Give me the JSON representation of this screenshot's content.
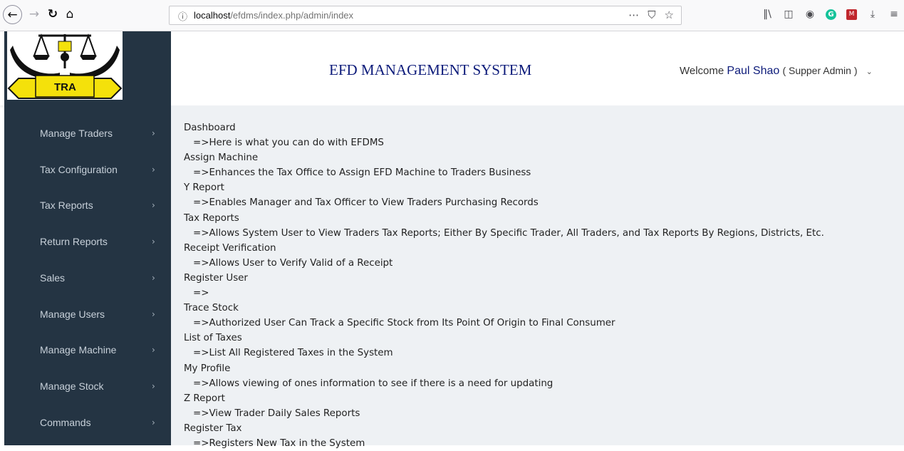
{
  "browser": {
    "url_prefix": "localhost",
    "url_rest": "/efdms/index.php/admin/index",
    "url_more": "⋯",
    "url_pocket": "⛉",
    "url_star": "☆"
  },
  "header": {
    "logo_text": "TRA",
    "title": "EFD MANAGEMENT SYSTEM",
    "welcome_prefix": "Welcome",
    "user_name": "Paul Shao",
    "user_role": "( Supper Admin )"
  },
  "sidebar": {
    "items": [
      {
        "label": "Manage Traders"
      },
      {
        "label": "Tax Configuration"
      },
      {
        "label": "Tax Reports"
      },
      {
        "label": "Return Reports"
      },
      {
        "label": "Sales"
      },
      {
        "label": "Manage Users"
      },
      {
        "label": "Manage Machine"
      },
      {
        "label": "Manage Stock"
      },
      {
        "label": "Commands"
      }
    ]
  },
  "main": {
    "entries": [
      {
        "title": "Dashboard",
        "desc": "=>Here is what you can do with EFDMS"
      },
      {
        "title": "Assign Machine",
        "desc": "=>Enhances the Tax Office to Assign EFD Machine to Traders Business"
      },
      {
        "title": "Y Report",
        "desc": "=>Enables Manager and Tax Officer to View Traders Purchasing Records"
      },
      {
        "title": "Tax Reports",
        "desc": "=>Allows System User to View Traders Tax Reports; Either By Specific Trader, All Traders, and Tax Reports By Regions, Districts, Etc."
      },
      {
        "title": "Receipt Verification",
        "desc": "=>Allows User to Verify Valid of a Receipt"
      },
      {
        "title": "Register User",
        "desc": "=>"
      },
      {
        "title": "Trace Stock",
        "desc": "=>Authorized User Can Track a Specific Stock from Its Point Of Origin to Final Consumer"
      },
      {
        "title": "List of Taxes",
        "desc": "=>List All Registered Taxes in the System"
      },
      {
        "title": "My Profile",
        "desc": "=>Allows viewing of ones information to see if there is a need for updating"
      },
      {
        "title": "Z Report",
        "desc": "=>View Trader Daily Sales Reports"
      },
      {
        "title": "Register Tax",
        "desc": "=>Registers New Tax in the System"
      }
    ]
  },
  "colors": {
    "sidebar_bg": "#243443",
    "main_bg": "#eef1f4",
    "title_blue": "#0d1b7a",
    "logo_yellow": "#f4e10b"
  }
}
